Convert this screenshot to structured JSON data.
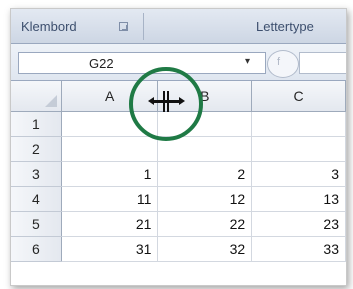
{
  "ribbon": {
    "groups": [
      "Klembord",
      "Lettertype"
    ]
  },
  "formula_bar": {
    "name_box": "G22",
    "dropdown_glyph": "▾",
    "fx_glyph": "f"
  },
  "sheet": {
    "corner": "",
    "columns": [
      "A",
      "B",
      "C"
    ],
    "rows": [
      {
        "num": "1",
        "cells": [
          "",
          "",
          ""
        ]
      },
      {
        "num": "2",
        "cells": [
          "",
          "",
          ""
        ]
      },
      {
        "num": "3",
        "cells": [
          "1",
          "2",
          "3"
        ]
      },
      {
        "num": "4",
        "cells": [
          "11",
          "12",
          "13"
        ]
      },
      {
        "num": "5",
        "cells": [
          "21",
          "22",
          "23"
        ]
      },
      {
        "num": "6",
        "cells": [
          "31",
          "32",
          "33"
        ]
      }
    ]
  },
  "highlight": {
    "color": "#1f7a45",
    "cursor": "column-resize-cursor"
  }
}
